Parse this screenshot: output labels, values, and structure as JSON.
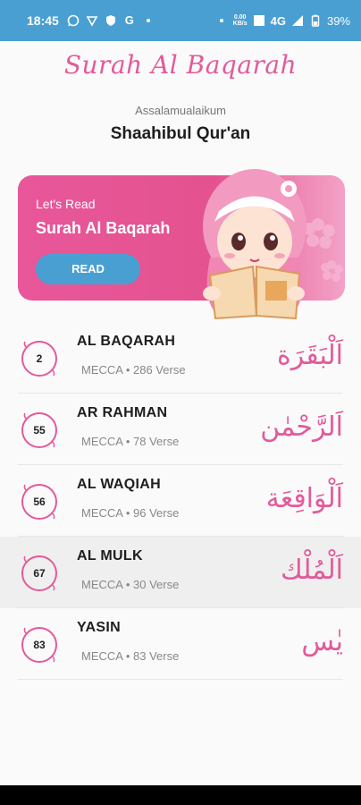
{
  "status_bar": {
    "time": "18:45",
    "left_icons": [
      "whatsapp-icon",
      "vpn-icon",
      "shield-icon",
      "google-icon",
      "dot-icon"
    ],
    "net_speed_top": "0.00",
    "net_speed_bottom": "KB/s",
    "network": "4G",
    "battery": "39%"
  },
  "app": {
    "title": "Surah Al Baqarah",
    "greeting": "Assalamualaikum",
    "user_name": "Shaahibul Qur'an"
  },
  "banner": {
    "pre_label": "Let's Read",
    "title": "Surah Al Baqarah",
    "button_label": "READ",
    "illustration": "girl-reading-quran-illustration"
  },
  "surahs": [
    {
      "number": "2",
      "name": "AL BAQARAH",
      "place": "MECCA",
      "verses": "286 Verse",
      "arabic": "اَلْبَقَرَة",
      "meta": "MECCA • 286 Verse"
    },
    {
      "number": "55",
      "name": "AR RAHMAN",
      "place": "MECCA",
      "verses": "78 Verse",
      "arabic": "اَلرَّحْمٰن",
      "meta": "MECCA • 78 Verse"
    },
    {
      "number": "56",
      "name": "AL WAQIAH",
      "place": "MECCA",
      "verses": "96 Verse",
      "arabic": "اَلْوَاقِعَة",
      "meta": "MECCA • 96 Verse"
    },
    {
      "number": "67",
      "name": "AL MULK",
      "place": "MECCA",
      "verses": "30 Verse",
      "arabic": "اَلْمُلْك",
      "meta": "MECCA • 30 Verse"
    },
    {
      "number": "83",
      "name": "YASIN",
      "place": "MECCA",
      "verses": "83 Verse",
      "arabic": "يٰس",
      "meta": "MECCA • 83 Verse"
    }
  ],
  "colors": {
    "primary_pink": "#e35a9a",
    "accent_blue": "#4a9fd2",
    "banner_gradient_start": "#e8579a",
    "banner_gradient_end": "#f3a2c6"
  }
}
